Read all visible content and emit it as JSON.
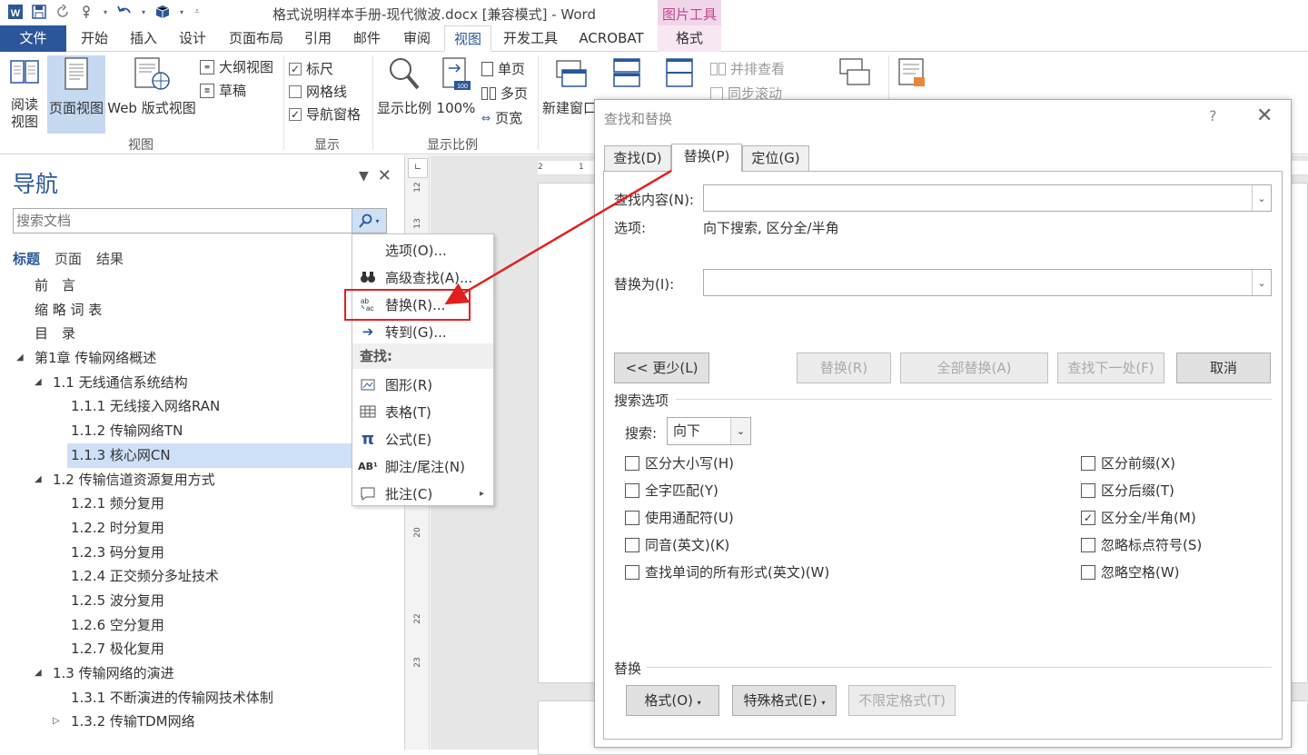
{
  "title_bar": {
    "doc_title": "格式说明样本手册-现代微波.docx [兼容模式] - Word",
    "picture_tools": "图片工具"
  },
  "ribbon_tabs": [
    "文件",
    "开始",
    "插入",
    "设计",
    "页面布局",
    "引用",
    "邮件",
    "审阅",
    "视图",
    "开发工具",
    "ACROBAT",
    "格式"
  ],
  "ribbon": {
    "views": {
      "read_mode": "阅读\n视图",
      "read_mode_l1": "阅读",
      "read_mode_l2": "视图",
      "print_layout": "页面视图",
      "web_layout": "Web 版式视图",
      "outline": "大纲视图",
      "draft": "草稿",
      "group_label": "视图"
    },
    "show": {
      "ruler": "标尺",
      "gridlines": "网格线",
      "nav_pane": "导航窗格",
      "ruler_checked": true,
      "gridlines_checked": false,
      "nav_pane_checked": true,
      "group_label": "显示"
    },
    "zoom": {
      "zoom": "显示比例",
      "hundred": "100%",
      "hundred_badge": "100",
      "one_page": "单页",
      "multi_page": "多页",
      "page_width": "页宽",
      "group_label": "显示比例"
    },
    "window": {
      "new_window": "新建窗口",
      "side_by_side": "并排查看",
      "sync_scroll": "同步滚动"
    }
  },
  "nav": {
    "title": "导航",
    "search_placeholder": "搜索文档",
    "subtabs": [
      "标题",
      "页面",
      "结果"
    ],
    "headings": [
      {
        "text": "前　言",
        "level": 0,
        "toggle": "",
        "selected": false
      },
      {
        "text": "缩 略 词 表",
        "level": 0,
        "toggle": "",
        "selected": false
      },
      {
        "text": "目　录",
        "level": 0,
        "toggle": "",
        "selected": false
      },
      {
        "text": "第1章  传输网络概述",
        "level": 0,
        "toggle": "open",
        "selected": false
      },
      {
        "text": "1.1 无线通信系统结构",
        "level": 1,
        "toggle": "open",
        "selected": false
      },
      {
        "text": "1.1.1 无线接入网络RAN",
        "level": 2,
        "toggle": "",
        "selected": false
      },
      {
        "text": "1.1.2 传输网络TN",
        "level": 2,
        "toggle": "",
        "selected": false
      },
      {
        "text": "1.1.3 核心网CN",
        "level": 2,
        "toggle": "",
        "selected": true
      },
      {
        "text": "1.2 传输信道资源复用方式",
        "level": 1,
        "toggle": "open",
        "selected": false
      },
      {
        "text": "1.2.1 频分复用",
        "level": 2,
        "toggle": "",
        "selected": false
      },
      {
        "text": "1.2.2 时分复用",
        "level": 2,
        "toggle": "",
        "selected": false
      },
      {
        "text": "1.2.3 码分复用",
        "level": 2,
        "toggle": "",
        "selected": false
      },
      {
        "text": "1.2.4 正交频分多址技术",
        "level": 2,
        "toggle": "",
        "selected": false
      },
      {
        "text": "1.2.5 波分复用",
        "level": 2,
        "toggle": "",
        "selected": false
      },
      {
        "text": "1.2.6 空分复用",
        "level": 2,
        "toggle": "",
        "selected": false
      },
      {
        "text": "1.2.7 极化复用",
        "level": 2,
        "toggle": "",
        "selected": false
      },
      {
        "text": "1.3 传输网络的演进",
        "level": 1,
        "toggle": "open",
        "selected": false
      },
      {
        "text": "1.3.1 不断演进的传输网技术体制",
        "level": 2,
        "toggle": "",
        "selected": false
      },
      {
        "text": "1.3.2 传输TDM网络",
        "level": 2,
        "toggle": "closed",
        "selected": false
      }
    ]
  },
  "search_menu": {
    "items": [
      {
        "label": "选项(O)...",
        "icon": "none"
      },
      {
        "label": "高级查找(A)...",
        "icon": "binoculars-icon"
      },
      {
        "label": "替换(R)...",
        "icon": "replace-icon"
      },
      {
        "label": "转到(G)...",
        "icon": "arrow-right-icon"
      }
    ],
    "find_header": "查找:",
    "find_items": [
      {
        "label": "图形(R)",
        "icon": "graphics-icon"
      },
      {
        "label": "表格(T)",
        "icon": "table-icon"
      },
      {
        "label": "公式(E)",
        "icon": "pi-icon"
      },
      {
        "label": "脚注/尾注(N)",
        "icon": "footnote-icon"
      },
      {
        "label": "批注(C)",
        "icon": "comment-icon"
      }
    ],
    "pi_glyph": "π",
    "footnote_glyph": "AB¹",
    "replace_glyph": "ab→ac",
    "submenu_arrow": "▸"
  },
  "ruler": {
    "vertical_ticks": [
      "12",
      "13",
      "20",
      "22",
      "23"
    ],
    "horizontal_ticks": [
      "2",
      "1"
    ]
  },
  "dialog": {
    "title": "查找和替换",
    "help": "?",
    "close": "✕",
    "tabs": [
      "查找(D)",
      "替换(P)",
      "定位(G)"
    ],
    "find_label": "查找内容(N):",
    "find_value": "",
    "options_label": "选项:",
    "options_value": "向下搜索, 区分全/半角",
    "replace_label": "替换为(I):",
    "replace_value": "",
    "btn_less": "<< 更少(L)",
    "btn_replace": "替换(R)",
    "btn_replace_all": "全部替换(A)",
    "btn_find_next": "查找下一处(F)",
    "btn_cancel": "取消",
    "search_options_label": "搜索选项",
    "search_label": "搜索:",
    "search_direction": "向下",
    "left_options": [
      {
        "label": "区分大小写(H)",
        "checked": false
      },
      {
        "label": "全字匹配(Y)",
        "checked": false
      },
      {
        "label": "使用通配符(U)",
        "checked": false
      },
      {
        "label": "同音(英文)(K)",
        "checked": false
      },
      {
        "label": "查找单词的所有形式(英文)(W)",
        "checked": false
      }
    ],
    "right_options": [
      {
        "label": "区分前缀(X)",
        "checked": false
      },
      {
        "label": "区分后缀(T)",
        "checked": false
      },
      {
        "label": "区分全/半角(M)",
        "checked": true
      },
      {
        "label": "忽略标点符号(S)",
        "checked": false
      },
      {
        "label": "忽略空格(W)",
        "checked": false
      }
    ],
    "replace_section": "替换",
    "btn_format": "格式(O)",
    "btn_special": "特殊格式(E)",
    "btn_no_format": "不限定格式(T)"
  },
  "colors": {
    "accent": "#2b579a",
    "annotation_red": "#e02020",
    "picture_tools_bg": "#f1d6ea"
  }
}
